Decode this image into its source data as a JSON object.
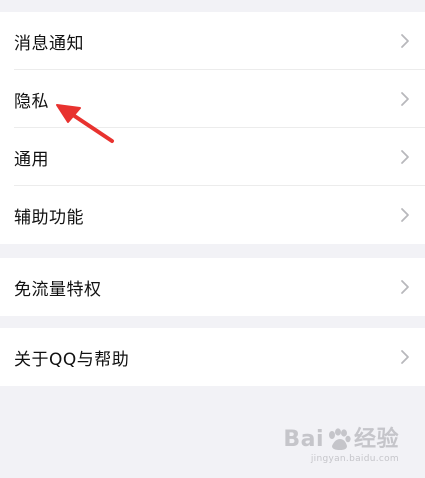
{
  "groups": [
    {
      "items": [
        {
          "label": "消息通知"
        },
        {
          "label": "隐私"
        },
        {
          "label": "通用"
        },
        {
          "label": "辅助功能"
        }
      ]
    },
    {
      "items": [
        {
          "label": "免流量特权"
        }
      ]
    },
    {
      "items": [
        {
          "label": "关于QQ与帮助"
        }
      ]
    }
  ],
  "annotation": {
    "color": "#e8322f",
    "icon": "arrow-pointer"
  },
  "watermark": {
    "brand_main": "Bai",
    "brand_suffix": "经验",
    "url": "jingyan.baidu.com"
  },
  "colors": {
    "background": "#f2f2f6",
    "row": "#ffffff",
    "separator": "#ececec",
    "chevron": "#b8b8bc"
  }
}
